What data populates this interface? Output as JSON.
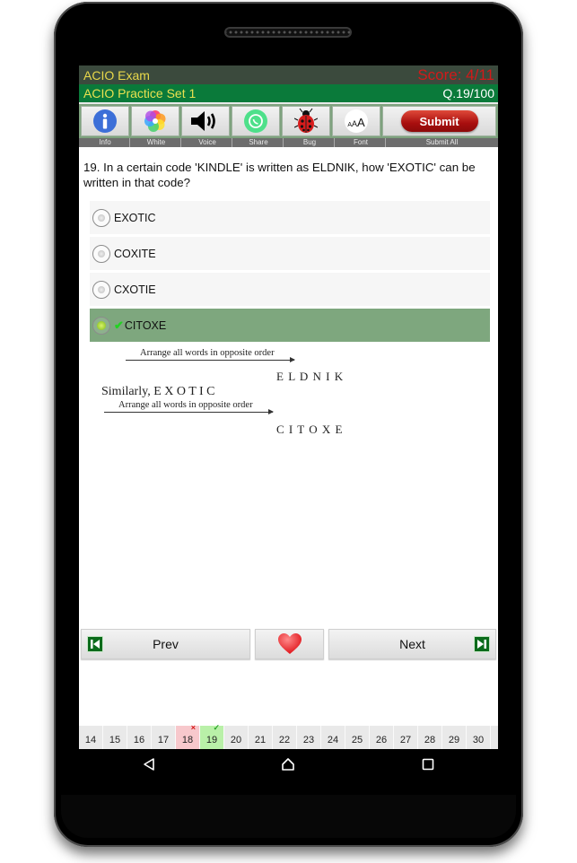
{
  "header": {
    "app_title": "ACIO Exam",
    "score": "Score: 4/11",
    "set_title": "ACIO Practice Set 1",
    "question_counter": "Q.19/100"
  },
  "toolbar": {
    "items": [
      {
        "icon": "info-icon",
        "label": "Info"
      },
      {
        "icon": "color-wheel-icon",
        "label": "White"
      },
      {
        "icon": "speaker-icon",
        "label": "Voice"
      },
      {
        "icon": "whatsapp-share-icon",
        "label": "Share"
      },
      {
        "icon": "ladybug-icon",
        "label": "Bug"
      },
      {
        "icon": "font-size-icon",
        "label": "Font",
        "glyph": "AAA"
      },
      {
        "icon": "submit-pill",
        "label": "Submit All",
        "button_text": "Submit"
      }
    ]
  },
  "question": {
    "text": "19. In a certain code 'KINDLE' is written as ELDNIK, how 'EXOTIC' can be written in that code?",
    "options": [
      {
        "label": "EXOTIC",
        "selected": false,
        "correct": false
      },
      {
        "label": "COXITE",
        "selected": false,
        "correct": false
      },
      {
        "label": "CXOTIE",
        "selected": false,
        "correct": false
      },
      {
        "label": "CITOXE",
        "selected": true,
        "correct": true
      }
    ],
    "correct_mark": "✔"
  },
  "explanation": {
    "line1_caption": "Arrange all words in opposite order",
    "line1_result": "E L D N I K",
    "line2_prefix": "Similarly, E X O T I C",
    "line2_caption": "Arrange all words in opposite order",
    "line2_result": "C I T O X E"
  },
  "navigation": {
    "prev_label": "Prev",
    "next_label": "Next",
    "favorite_icon": "heart-icon"
  },
  "question_strip": {
    "items": [
      {
        "n": "14",
        "status": ""
      },
      {
        "n": "15",
        "status": ""
      },
      {
        "n": "16",
        "status": ""
      },
      {
        "n": "17",
        "status": ""
      },
      {
        "n": "18",
        "status": "wrong",
        "mark": "×"
      },
      {
        "n": "19",
        "status": "right",
        "mark": "✓"
      },
      {
        "n": "20",
        "status": ""
      },
      {
        "n": "21",
        "status": ""
      },
      {
        "n": "22",
        "status": ""
      },
      {
        "n": "23",
        "status": ""
      },
      {
        "n": "24",
        "status": ""
      },
      {
        "n": "25",
        "status": ""
      },
      {
        "n": "26",
        "status": ""
      },
      {
        "n": "27",
        "status": ""
      },
      {
        "n": "28",
        "status": ""
      },
      {
        "n": "29",
        "status": ""
      },
      {
        "n": "30",
        "status": ""
      }
    ]
  },
  "system_nav": {
    "back": "back-icon",
    "home": "home-icon",
    "recents": "recents-icon"
  },
  "colors": {
    "title_bar": "#3b4a3d",
    "sub_bar": "#0a7a3a",
    "title_text": "#e8d84a",
    "score_text": "#d21a1a",
    "correct_option": "#7ea77e",
    "wrong_cell": "#f7c8cc",
    "right_cell": "#b9f0a8"
  }
}
